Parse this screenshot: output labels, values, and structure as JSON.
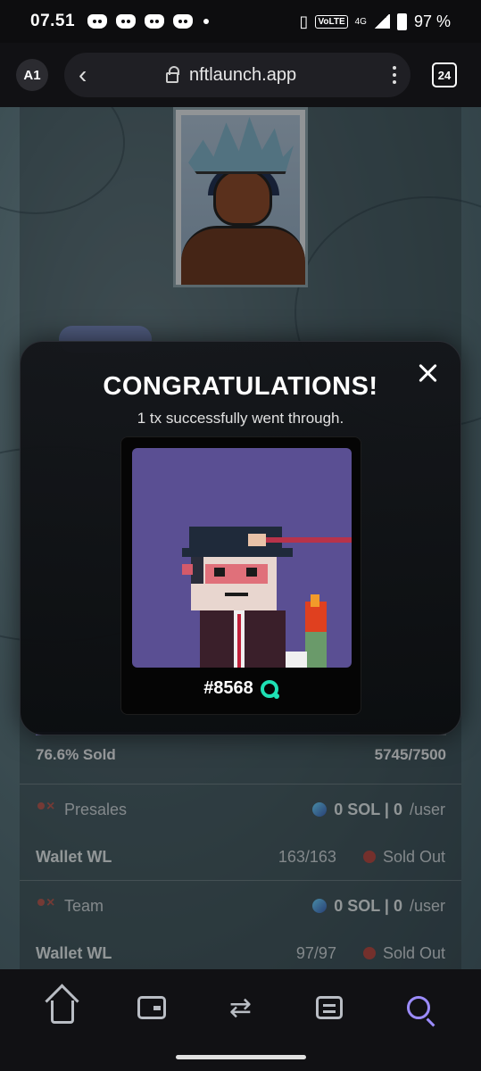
{
  "status_bar": {
    "time": "07.51",
    "volte": "VoLTE",
    "network": "4G",
    "battery": "97 %"
  },
  "browser": {
    "profile": "A1",
    "url": "nftlaunch.app",
    "tab_count": "24"
  },
  "launch": {
    "progress_percent": 76.6,
    "sold_label": "76.6% Sold",
    "sold_count": "5745/7500",
    "phases": [
      {
        "name": "Presales",
        "price": "0 SOL | 0",
        "per_user": "/user",
        "list": "Wallet WL",
        "count": "163/163",
        "status": "Sold Out"
      },
      {
        "name": "Team",
        "price": "0 SOL | 0",
        "per_user": "/user",
        "list": "Wallet WL",
        "count": "97/97",
        "status": "Sold Out"
      }
    ]
  },
  "modal": {
    "title": "CONGRATULATIONS!",
    "subtitle": "1 tx successfully went through.",
    "token_id": "#8568"
  },
  "colors": {
    "accent": "#9c8cff",
    "danger": "#b24a44",
    "mint_badge": "#1ee0b4"
  }
}
